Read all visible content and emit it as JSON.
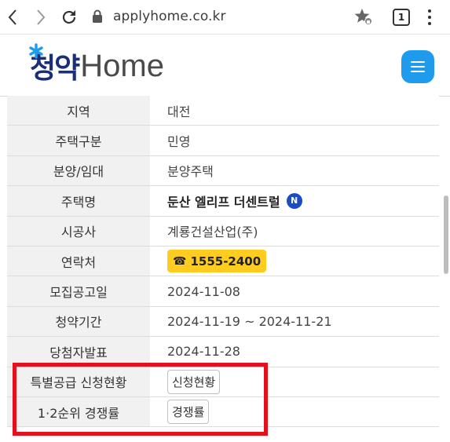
{
  "browser": {
    "url": "applyhome.co.kr",
    "tab_count": "1"
  },
  "site": {
    "logo_korean": "청약",
    "logo_english": "Home",
    "logo_star_color": "#1e9bed"
  },
  "rows": [
    {
      "label": "지역",
      "value": "대전"
    },
    {
      "label": "주택구분",
      "value": "민영"
    },
    {
      "label": "분양/임대",
      "value": "분양주택"
    },
    {
      "label": "주택명",
      "value": "둔산 엘리프 더센트럴",
      "badge": "N"
    },
    {
      "label": "시공사",
      "value": "계룡건설산업(주)"
    },
    {
      "label": "연락처",
      "value": "1555-2400",
      "icon": "☎"
    },
    {
      "label": "모집공고일",
      "value": "2024-11-08"
    },
    {
      "label": "청약기간",
      "value": "2024-11-19 ~ 2024-11-21"
    },
    {
      "label": "당첨자발표",
      "value": "2024-11-28"
    },
    {
      "label": "특별공급 신청현황",
      "value": "신청현황"
    },
    {
      "label": "1·2순위 경쟁률",
      "value": "경쟁률"
    }
  ],
  "colors": {
    "accent": "#1e9bed",
    "phone_badge": "#ffcc1f",
    "new_badge": "#1c4cc3",
    "highlight": "#e3101e"
  }
}
